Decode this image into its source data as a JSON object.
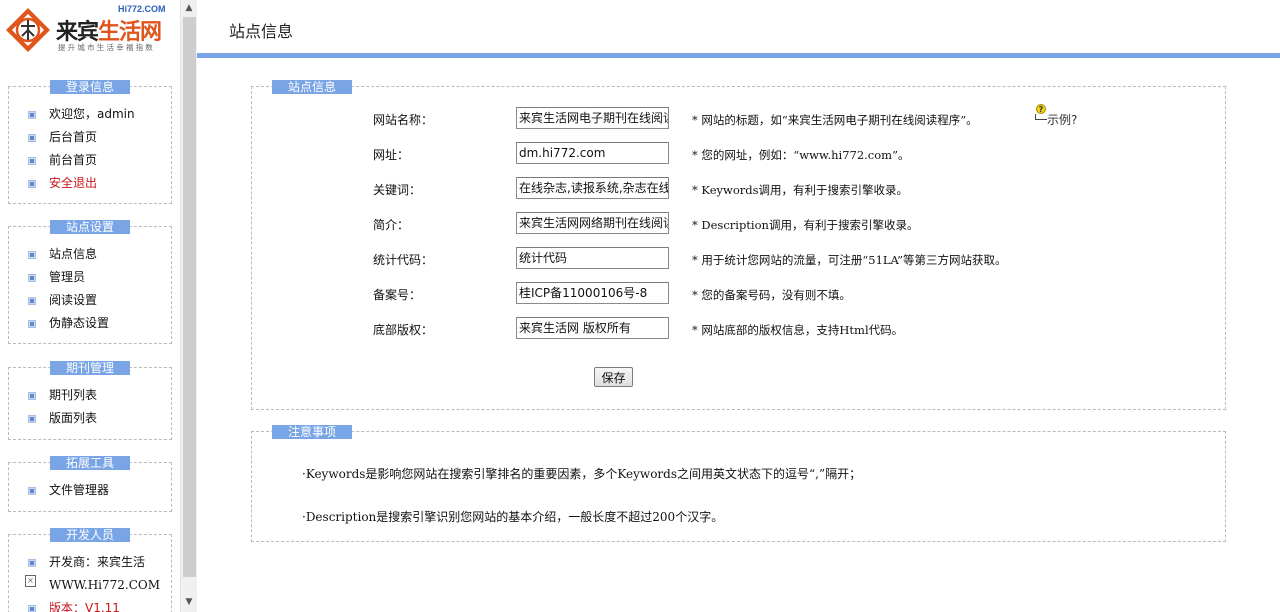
{
  "logo": {
    "site": "Hi772.COM",
    "name_a": "来宾",
    "name_b": "生活网",
    "slogan": "提升城市生活幸福指数"
  },
  "sidebar": {
    "sections": [
      {
        "title": "登录信息",
        "items": [
          {
            "label": "欢迎您，admin"
          },
          {
            "label": "后台首页"
          },
          {
            "label": "前台首页"
          },
          {
            "label": "安全退出"
          }
        ]
      },
      {
        "title": "站点设置",
        "items": [
          {
            "label": "站点信息"
          },
          {
            "label": "管理员"
          },
          {
            "label": "阅读设置"
          },
          {
            "label": "伪静态设置"
          }
        ]
      },
      {
        "title": "期刊管理",
        "items": [
          {
            "label": "期刊列表"
          },
          {
            "label": "版面列表"
          }
        ]
      },
      {
        "title": "拓展工具",
        "items": [
          {
            "label": "文件管理器"
          }
        ]
      },
      {
        "title": "开发人员",
        "items": [
          {
            "label": "开发商：来宾生活"
          },
          {
            "label": "WWW.Hi772.COM"
          },
          {
            "label": "版本：V1.11"
          }
        ]
      }
    ]
  },
  "header": {
    "title": "站点信息"
  },
  "site_panel": {
    "title": "站点信息",
    "rows": [
      {
        "label": "网站名称：",
        "value": "来宾生活网电子期刊在线阅读程序",
        "hint": "* 网站的标题，如“来宾生活网电子期刊在线阅读程序”。"
      },
      {
        "label": "网址：",
        "value": "dm.hi772.com",
        "hint": "* 您的网址，例如：“www.hi772.com”。"
      },
      {
        "label": "关键词：",
        "value": "在线杂志,读报系统,杂志在线",
        "hint": "* Keywords调用，有利于搜索引擎收录。"
      },
      {
        "label": "简介：",
        "value": "来宾生活网网络期刊在线阅读",
        "hint": "* Description调用，有利于搜索引擎收录。"
      },
      {
        "label": "统计代码：",
        "value": "统计代码",
        "hint": "* 用于统计您网站的流量，可注册“51LA”等第三方网站获取。"
      },
      {
        "label": "备案号：",
        "value": "桂ICP备11000106号-8",
        "hint": "* 您的备案号码，没有则不填。"
      },
      {
        "label": "底部版权：",
        "value": "来宾生活网 版权所有",
        "hint": "* 网站底部的版权信息，支持Html代码。"
      }
    ],
    "example_label": "示例?",
    "save_label": "保存"
  },
  "notes_panel": {
    "title": "注意事项",
    "notes": [
      "·Keywords是影响您网站在搜索引擎排名的重要因素，多个Keywords之间用英文状态下的逗号“,”隔开；",
      "·Description是搜索引擎识别您网站的基本介绍，一般长度不超过200个汉字。"
    ]
  },
  "scrollbar": {
    "up_icon": "▲",
    "down_icon": "▼"
  }
}
